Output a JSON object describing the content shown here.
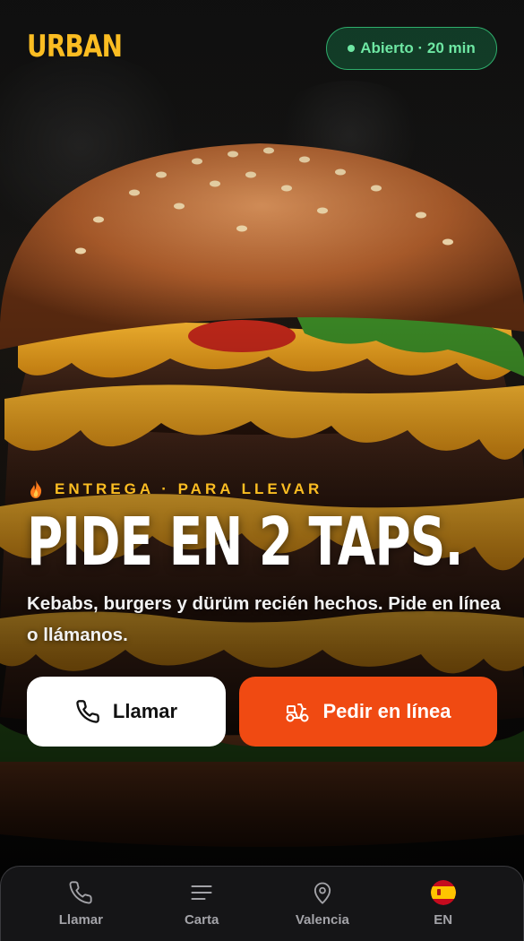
{
  "brand": {
    "name": "URBAN",
    "color": "#fbbd22"
  },
  "status": {
    "label": "Abierto · 20 min",
    "icon": "status-dot",
    "color": "#6ee7a3"
  },
  "hero": {
    "tagline": "ENTREGA · PARA LLEVAR",
    "tagline_icon": "flame-icon",
    "headline": "PIDE EN 2 TAPS.",
    "subtext": "Kebabs, burgers y dürüm recién hechos. Pide en línea o llámanos.",
    "image": "burger-photo"
  },
  "actions": {
    "call": {
      "label": "Llamar",
      "icon": "phone-icon"
    },
    "order": {
      "label": "Pedir en línea",
      "icon": "scooter-icon",
      "color": "#f04a12"
    }
  },
  "bottom_nav": {
    "items": [
      {
        "label": "Llamar",
        "icon": "phone-icon"
      },
      {
        "label": "Carta",
        "icon": "menu-icon"
      },
      {
        "label": "Valencia",
        "icon": "map-pin-icon"
      },
      {
        "label": "EN",
        "icon": "spain-flag-icon"
      }
    ]
  }
}
